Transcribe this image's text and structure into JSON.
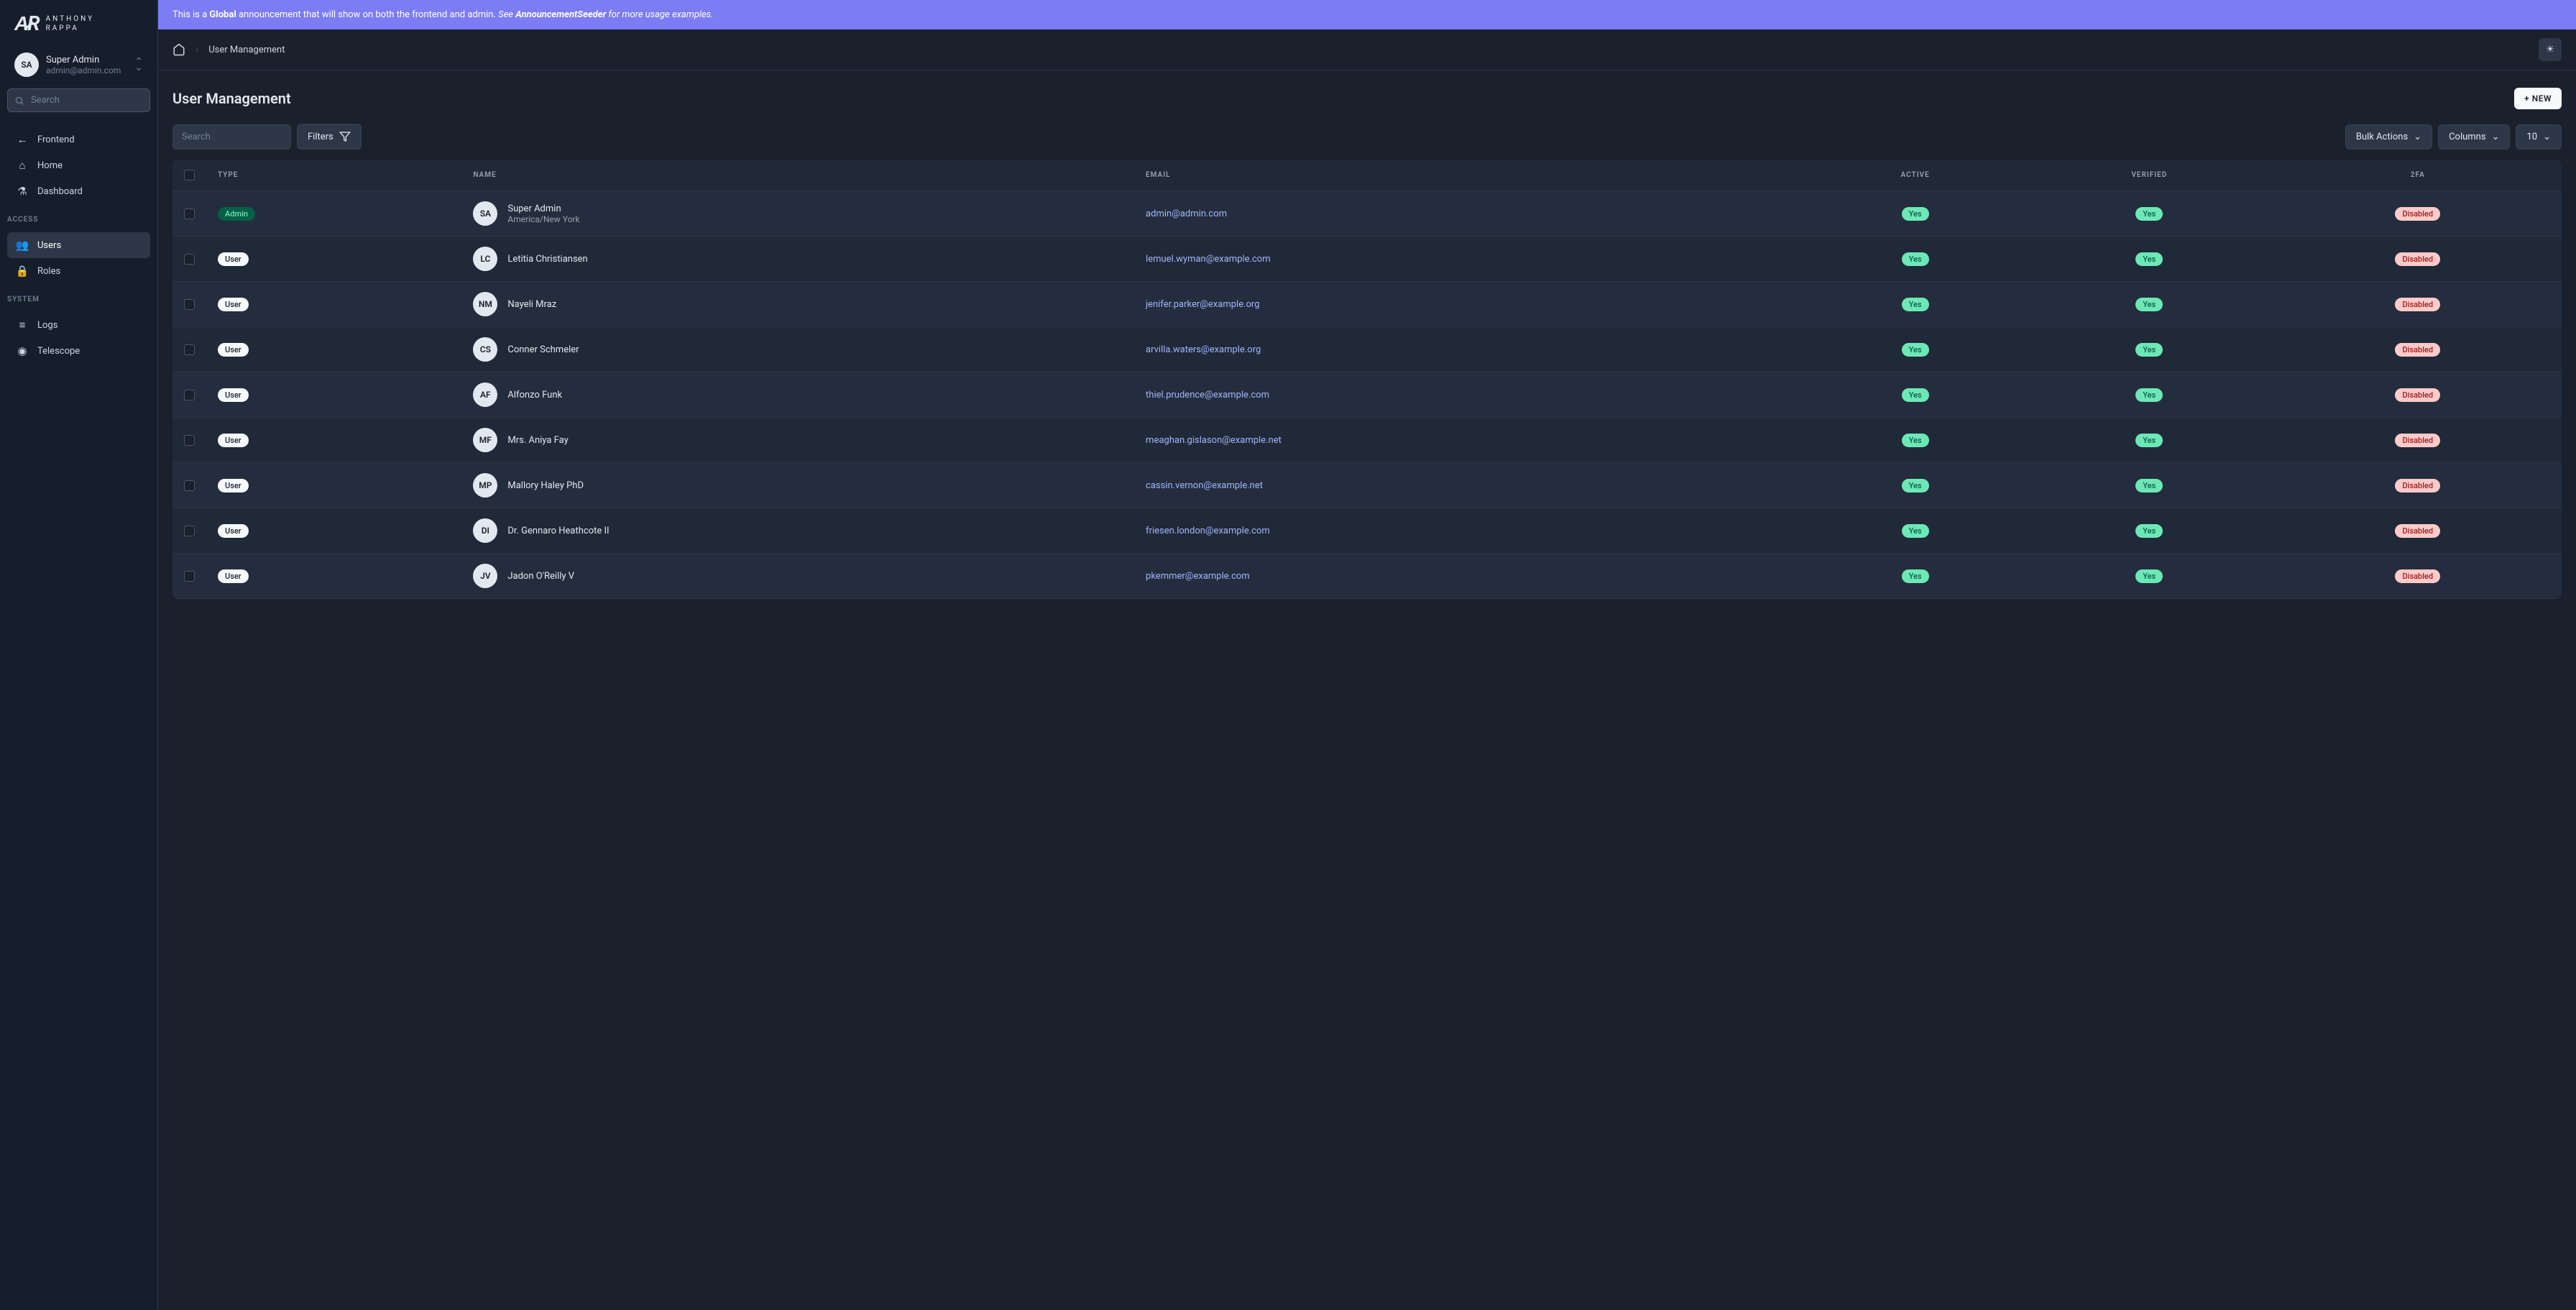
{
  "logo": {
    "line1": "ANTHONY",
    "line2": "RAPPA"
  },
  "currentUser": {
    "initials": "SA",
    "name": "Super Admin",
    "email": "admin@admin.com"
  },
  "sidebar": {
    "searchPlaceholder": "Search",
    "top": [
      {
        "label": "Frontend",
        "icon": "←"
      },
      {
        "label": "Home",
        "icon": "⌂"
      },
      {
        "label": "Dashboard",
        "icon": "⚗"
      }
    ],
    "accessHeader": "ACCESS",
    "access": [
      {
        "label": "Users",
        "icon": "👥",
        "active": true
      },
      {
        "label": "Roles",
        "icon": "🔒"
      }
    ],
    "systemHeader": "SYSTEM",
    "system": [
      {
        "label": "Logs",
        "icon": "≡"
      },
      {
        "label": "Telescope",
        "icon": "◉"
      }
    ]
  },
  "announcement": {
    "t1": "This is a ",
    "b1": "Global",
    "t2": " announcement that will show on both the frontend and admin. ",
    "i1": "See ",
    "bi": "AnnouncementSeeder",
    "i2": " for more usage examples."
  },
  "breadcrumb": "User Management",
  "pageTitle": "User Management",
  "newButton": "+ NEW",
  "toolbar": {
    "searchPlaceholder": "Search",
    "filters": "Filters",
    "bulkActions": "Bulk Actions",
    "columns": "Columns",
    "perPage": "10"
  },
  "headers": {
    "type": "TYPE",
    "name": "NAME",
    "email": "EMAIL",
    "active": "ACTIVE",
    "verified": "VERIFIED",
    "twofa": "2FA"
  },
  "badges": {
    "yes": "Yes",
    "disabled": "Disabled",
    "admin": "Admin",
    "user": "User"
  },
  "users": [
    {
      "type": "admin",
      "initials": "SA",
      "name": "Super Admin",
      "sub": "America/New York",
      "email": "admin@admin.com"
    },
    {
      "type": "user",
      "initials": "LC",
      "name": "Letitia Christiansen",
      "email": "lemuel.wyman@example.com"
    },
    {
      "type": "user",
      "initials": "NM",
      "name": "Nayeli Mraz",
      "email": "jenifer.parker@example.org"
    },
    {
      "type": "user",
      "initials": "CS",
      "name": "Conner Schmeler",
      "email": "arvilla.waters@example.org"
    },
    {
      "type": "user",
      "initials": "AF",
      "name": "Alfonzo Funk",
      "email": "thiel.prudence@example.com"
    },
    {
      "type": "user",
      "initials": "MF",
      "name": "Mrs. Aniya Fay",
      "email": "meaghan.gislason@example.net"
    },
    {
      "type": "user",
      "initials": "MP",
      "name": "Mallory Haley PhD",
      "email": "cassin.vernon@example.net"
    },
    {
      "type": "user",
      "initials": "DI",
      "name": "Dr. Gennaro Heathcote II",
      "email": "friesen.london@example.com"
    },
    {
      "type": "user",
      "initials": "JV",
      "name": "Jadon O'Reilly V",
      "email": "pkemmer@example.com"
    }
  ]
}
